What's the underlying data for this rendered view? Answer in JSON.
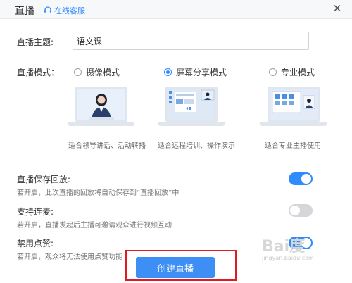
{
  "header": {
    "title": "直播",
    "support_label": "在线客服",
    "close_symbol": "✕"
  },
  "topic": {
    "label": "直播主题:",
    "value": "语文课"
  },
  "mode": {
    "label": "直播模式：",
    "options": [
      {
        "label": "摄像模式",
        "caption": "适合领导讲话、活动转播",
        "selected": false
      },
      {
        "label": "屏幕分享模式",
        "caption": "适合远程培训、操作演示",
        "selected": true
      },
      {
        "label": "专业模式",
        "caption": "适合专业主播使用",
        "selected": false
      }
    ]
  },
  "options": [
    {
      "title": "直播保存回放:",
      "desc": "若开启，此次直播的回放将自动保存到“直播回放”中",
      "on": true
    },
    {
      "title": "支持连麦:",
      "desc": "若开启，直播发起后主播可邀请观众进行视频互动",
      "on": false
    },
    {
      "title": "禁用点赞:",
      "desc": "若开启，观众将无法使用点赞功能",
      "on": true
    }
  ],
  "create_button": "创建直播",
  "watermark": {
    "text": "Bai度",
    "sub": "jingyan.baidu.com"
  },
  "colors": {
    "accent": "#2f8cff",
    "button": "#3d8ff5",
    "highlight": "#e11b22",
    "toggle_off": "#d4d6d9"
  }
}
